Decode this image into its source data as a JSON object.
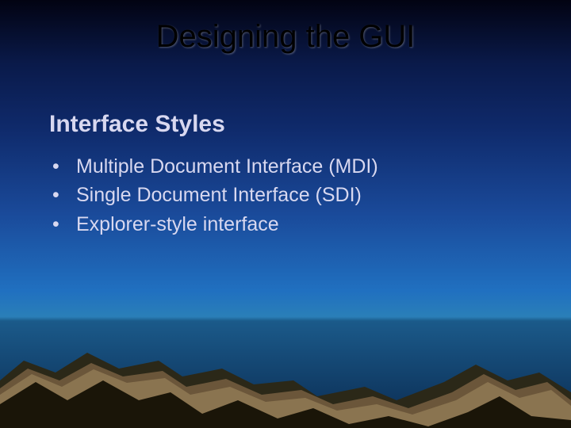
{
  "slide": {
    "title": "Designing the GUI",
    "subtitle": "Interface Styles",
    "bullets": [
      "Multiple Document Interface (MDI)",
      "Single Document Interface (SDI)",
      "Explorer-style interface"
    ]
  }
}
